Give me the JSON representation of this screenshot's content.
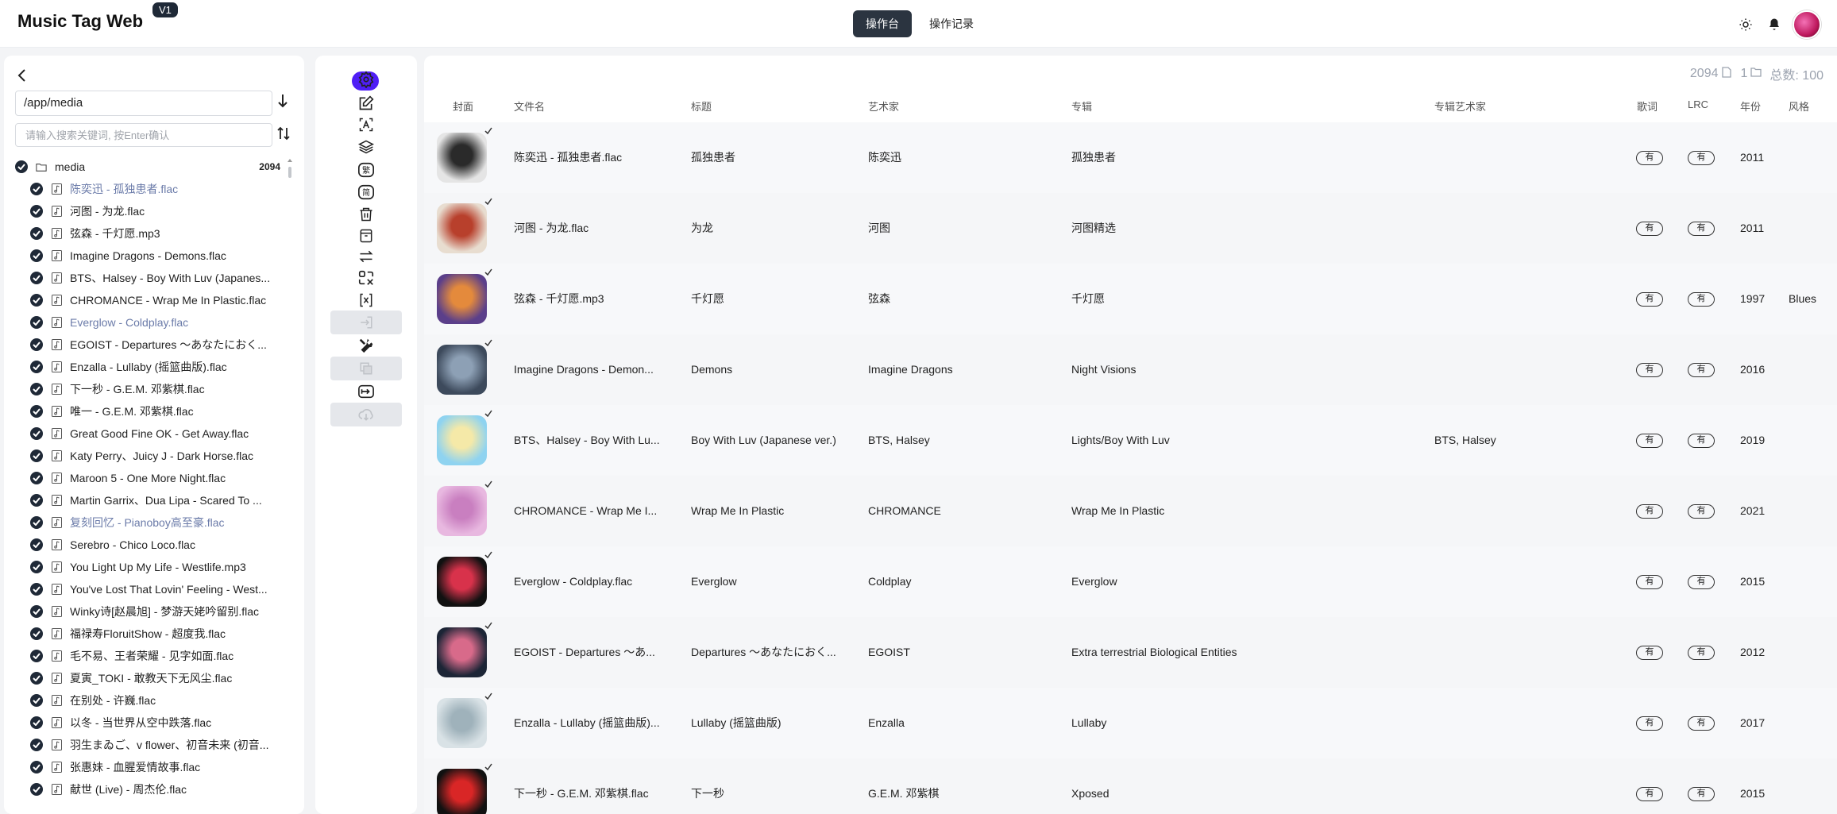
{
  "header": {
    "title": "Music Tag Web",
    "version": "V1",
    "tabs": [
      {
        "label": "操作台",
        "active": true
      },
      {
        "label": "操作记录",
        "active": false
      }
    ]
  },
  "sidebar": {
    "path": "/app/media",
    "search_placeholder": "请输入搜索关键词, 按Enter确认",
    "root": {
      "name": "media",
      "count": "2094"
    },
    "files": [
      {
        "name": "陈奕迅 - 孤独患者.flac",
        "dim": true
      },
      {
        "name": "河图 - 为龙.flac",
        "dim": false
      },
      {
        "name": "弦森 - 千灯愿.mp3",
        "dim": false
      },
      {
        "name": "Imagine Dragons - Demons.flac",
        "dim": false
      },
      {
        "name": "BTS、Halsey - Boy With Luv (Japanes...",
        "dim": false
      },
      {
        "name": "CHROMANCE - Wrap Me In Plastic.flac",
        "dim": false
      },
      {
        "name": "Everglow - Coldplay.flac",
        "dim": true
      },
      {
        "name": "EGOIST - Departures ～あなたにおく...",
        "dim": false
      },
      {
        "name": "Enzalla - Lullaby (摇篮曲版).flac",
        "dim": false
      },
      {
        "name": "下一秒 - G.E.M. 邓紫棋.flac",
        "dim": false
      },
      {
        "name": "唯一 - G.E.M. 邓紫棋.flac",
        "dim": false
      },
      {
        "name": "Great Good Fine OK - Get Away.flac",
        "dim": false
      },
      {
        "name": "Katy Perry、Juicy J - Dark Horse.flac",
        "dim": false
      },
      {
        "name": "Maroon 5 - One More Night.flac",
        "dim": false
      },
      {
        "name": "Martin Garrix、Dua Lipa - Scared To ...",
        "dim": false
      },
      {
        "name": "复刻回忆 - Pianoboy高至豪.flac",
        "dim": true
      },
      {
        "name": "Serebro - Chico Loco.flac",
        "dim": false
      },
      {
        "name": "You Light Up My Life - Westlife.mp3",
        "dim": false
      },
      {
        "name": "You've Lost That Lovin' Feeling - West...",
        "dim": false
      },
      {
        "name": "Winky诗[赵晨旭] - 梦游天姥吟留别.flac",
        "dim": false
      },
      {
        "name": "福禄寿FloruitShow - 超度我.flac",
        "dim": false
      },
      {
        "name": "毛不易、王者荣耀 - 见字如面.flac",
        "dim": false
      },
      {
        "name": "夏寅_TOKI - 敢教天下无风尘.flac",
        "dim": false
      },
      {
        "name": "在别处 - 许巍.flac",
        "dim": false
      },
      {
        "name": "以冬 - 当世界从空中跌落.flac",
        "dim": false
      },
      {
        "name": "羽生まゐご、v flower、初音未来 (初音...",
        "dim": false
      },
      {
        "name": "张惠妹 - 血腥爱情故事.flac",
        "dim": false
      },
      {
        "name": "献世 (Live) - 周杰伦.flac",
        "dim": false
      }
    ]
  },
  "toolbar": {
    "icons": [
      "gear-icon",
      "edit-icon",
      "text-a-icon",
      "layers-icon",
      "traditional-chinese-icon",
      "simplified-chinese-icon",
      "trash-icon",
      "archive-icon",
      "swap-icon",
      "scan-icon",
      "match-icon",
      "import-icon",
      "tools-icon",
      "copy-icon",
      "convert-icon",
      "download-icon"
    ]
  },
  "stats": {
    "files": "2094",
    "folders": "1",
    "total_label": "总数: 100"
  },
  "table": {
    "headers": {
      "cover": "封面",
      "filename": "文件名",
      "title": "标题",
      "artist": "艺术家",
      "album": "专辑",
      "album_artist": "专辑艺术家",
      "lyrics": "歌词",
      "lrc": "LRC",
      "year": "年份",
      "genre": "风格"
    },
    "rows": [
      {
        "filename": "陈奕迅 - 孤独患者.flac",
        "title": "孤独患者",
        "artist": "陈奕迅",
        "album": "孤独患者",
        "album_artist": "",
        "lyrics": "有",
        "lrc": "有",
        "year": "2011",
        "genre": "",
        "cover_colors": [
          "#e5e5e5",
          "#2a2a2a"
        ]
      },
      {
        "filename": "河图 - 为龙.flac",
        "title": "为龙",
        "artist": "河图",
        "album": "河图精选",
        "album_artist": "",
        "lyrics": "有",
        "lrc": "有",
        "year": "2011",
        "genre": "",
        "cover_colors": [
          "#e8ddd0",
          "#b8402c"
        ]
      },
      {
        "filename": "弦森 - 千灯愿.mp3",
        "title": "千灯愿",
        "artist": "弦森",
        "album": "千灯愿",
        "album_artist": "",
        "lyrics": "有",
        "lrc": "有",
        "year": "1997",
        "genre": "Blues",
        "cover_colors": [
          "#5b3f8a",
          "#e48a3c"
        ]
      },
      {
        "filename": "Imagine Dragons - Demon...",
        "title": "Demons",
        "artist": "Imagine Dragons",
        "album": "Night Visions",
        "album_artist": "",
        "lyrics": "有",
        "lrc": "有",
        "year": "2016",
        "genre": "",
        "cover_colors": [
          "#3d4a5c",
          "#8da0b5"
        ]
      },
      {
        "filename": "BTS、Halsey - Boy With Lu...",
        "title": "Boy With Luv (Japanese ver.)",
        "artist": "BTS, Halsey",
        "album": "Lights/Boy With Luv",
        "album_artist": "BTS, Halsey",
        "lyrics": "有",
        "lrc": "有",
        "year": "2019",
        "genre": "",
        "cover_colors": [
          "#8fd3f0",
          "#f5e9a8"
        ]
      },
      {
        "filename": "CHROMANCE - Wrap Me I...",
        "title": "Wrap Me In Plastic",
        "artist": "CHROMANCE",
        "album": "Wrap Me In Plastic",
        "album_artist": "",
        "lyrics": "有",
        "lrc": "有",
        "year": "2021",
        "genre": "",
        "cover_colors": [
          "#e8b8e0",
          "#c97fc0"
        ]
      },
      {
        "filename": "Everglow - Coldplay.flac",
        "title": "Everglow",
        "artist": "Coldplay",
        "album": "Everglow",
        "album_artist": "",
        "lyrics": "有",
        "lrc": "有",
        "year": "2015",
        "genre": "",
        "cover_colors": [
          "#111111",
          "#d8324b"
        ]
      },
      {
        "filename": "EGOIST - Departures ～あ...",
        "title": "Departures ～あなたにおく...",
        "artist": "EGOIST",
        "album": "Extra terrestrial Biological Entities",
        "album_artist": "",
        "lyrics": "有",
        "lrc": "有",
        "year": "2012",
        "genre": "",
        "cover_colors": [
          "#1c2536",
          "#d86a8a"
        ]
      },
      {
        "filename": "Enzalla - Lullaby (摇篮曲版)...",
        "title": "Lullaby (摇篮曲版)",
        "artist": "Enzalla",
        "album": "Lullaby",
        "album_artist": "",
        "lyrics": "有",
        "lrc": "有",
        "year": "2017",
        "genre": "",
        "cover_colors": [
          "#d9e2e6",
          "#9fb2bb"
        ]
      },
      {
        "filename": "下一秒 - G.E.M. 邓紫棋.flac",
        "title": "下一秒",
        "artist": "G.E.M. 邓紫棋",
        "album": "Xposed",
        "album_artist": "",
        "lyrics": "有",
        "lrc": "有",
        "year": "2015",
        "genre": "",
        "cover_colors": [
          "#111111",
          "#d92626"
        ]
      }
    ]
  }
}
